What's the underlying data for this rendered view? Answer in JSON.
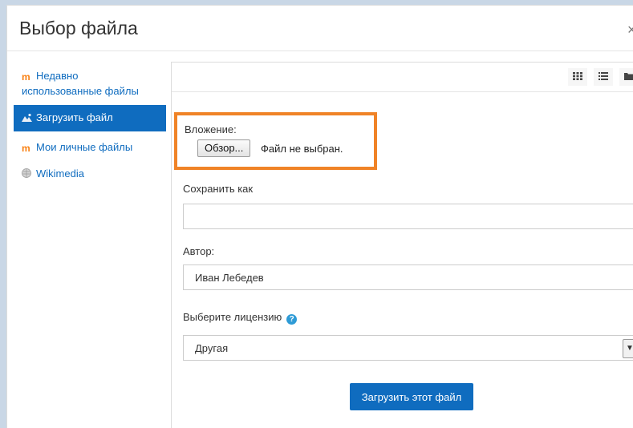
{
  "dialog": {
    "title": "Выбор файла",
    "close_glyph": "×"
  },
  "sidebar": {
    "items": [
      {
        "label": "Недавно использованные файлы",
        "icon": "moodle-icon",
        "active": false
      },
      {
        "label": "Загрузить файл",
        "icon": "upload-icon",
        "active": true
      },
      {
        "label": "Мои личные файлы",
        "icon": "moodle-icon",
        "active": false
      },
      {
        "label": "Wikimedia",
        "icon": "wikimedia-icon",
        "active": false
      }
    ]
  },
  "toolbar": {
    "views": [
      "grid-view-icon",
      "list-view-icon",
      "folder-view-icon"
    ]
  },
  "form": {
    "attachment_label": "Вложение:",
    "browse_button": "Обзор...",
    "no_file_text": "Файл не выбран.",
    "save_as_label": "Сохранить как",
    "save_as_value": "",
    "author_label": "Автор:",
    "author_value": "Иван Лебедев",
    "license_label": "Выберите лицензию",
    "license_value": "Другая",
    "submit_button": "Загрузить этот файл"
  },
  "colors": {
    "accent": "#0f6cbf",
    "highlight_border": "#f08327",
    "moodle_logo": "#f98012",
    "help_icon": "#2e9bd6"
  }
}
